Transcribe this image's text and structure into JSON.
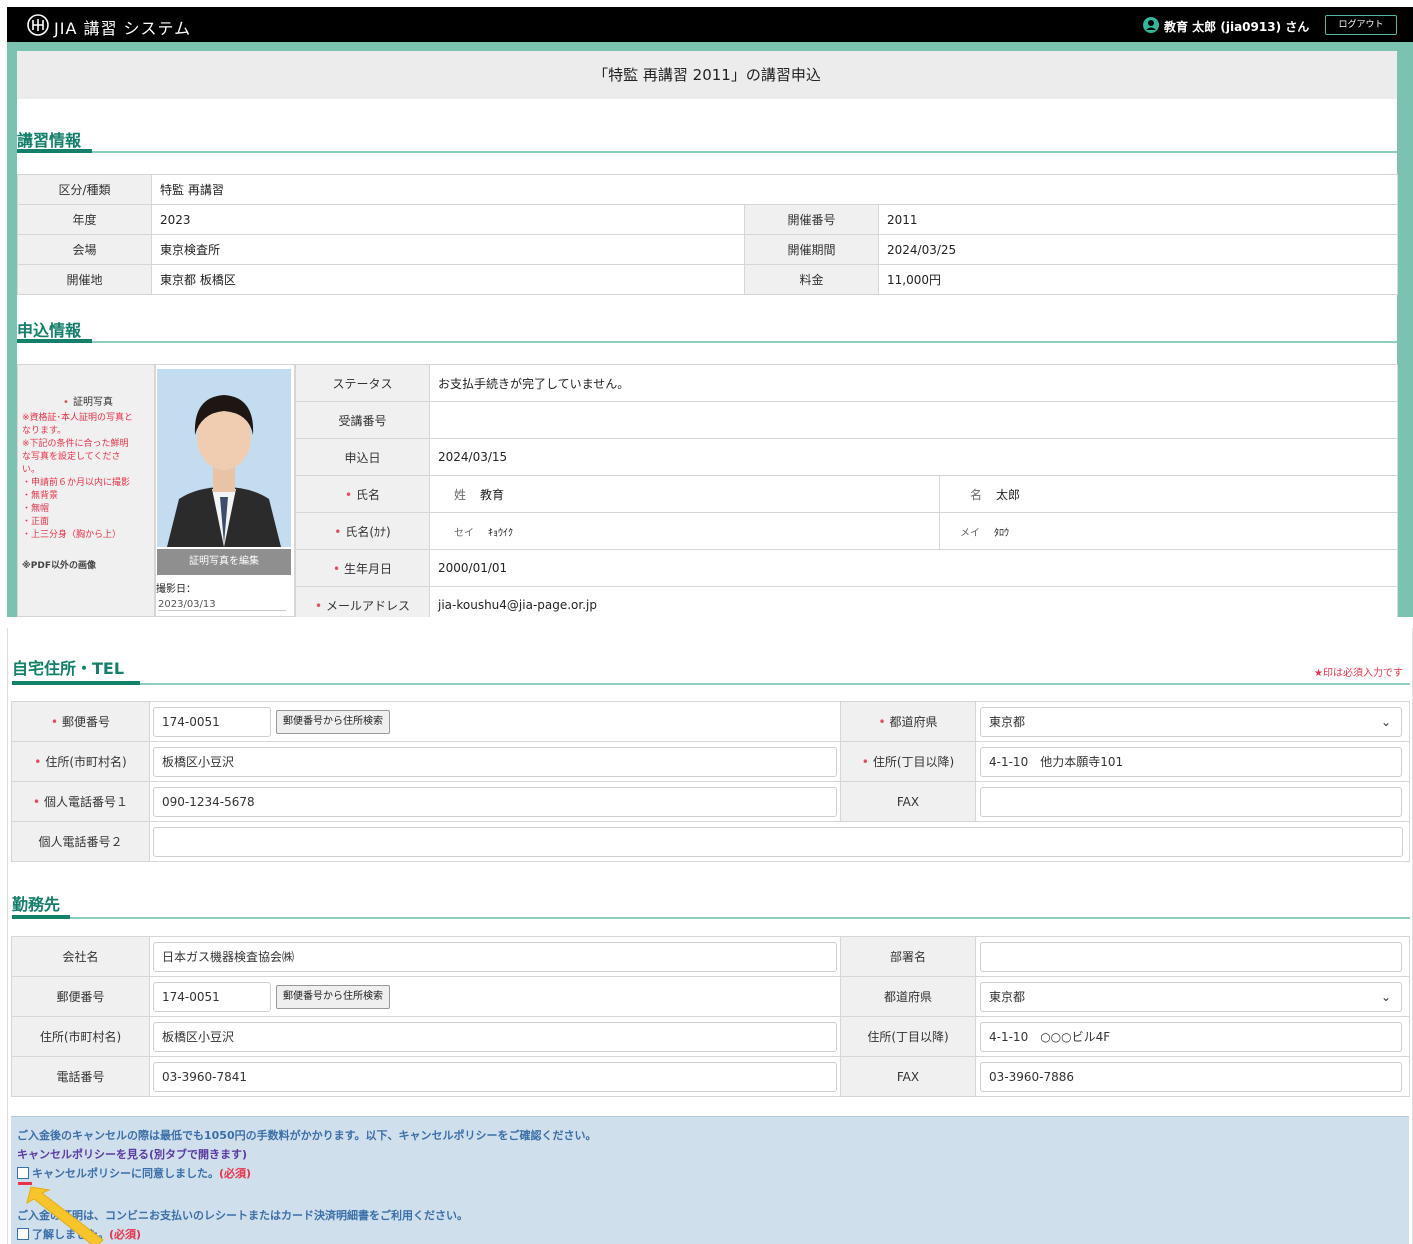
{
  "header": {
    "app_title": "JIA 講習 システム",
    "user_name": "教育 太郎 (jia0913) さん",
    "logout_label": "ログアウト"
  },
  "page_title": "「特監 再講習 2011」の講習申込",
  "course_section": {
    "heading": "講習情報",
    "rows": [
      {
        "l1": "区分/種類",
        "v1": "特監 再講習"
      },
      {
        "l1": "年度",
        "v1": "2023",
        "l2": "開催番号",
        "v2": "2011"
      },
      {
        "l1": "会場",
        "v1": "東京検査所",
        "l2": "開催期間",
        "v2": "2024/03/25"
      },
      {
        "l1": "開催地",
        "v1": "東京都 板橋区",
        "l2": "料金",
        "v2": "11,000円"
      }
    ]
  },
  "application_section": {
    "heading": "申込情報",
    "photo_note": {
      "title": "証明写真",
      "lines": [
        "※資格証･本人証明の写真と",
        "なります。",
        "※下記の条件に合った鮮明",
        "な写真を設定してくださ",
        "い。",
        "・申請前６か月以内に撮影",
        "・無背景",
        "・無帽",
        "・正面",
        "・上三分身（胸から上）"
      ],
      "pdf_note": "※PDF以外の画像"
    },
    "photo_edit_label": "証明写真を編集",
    "photo_date_label": "撮影日：",
    "photo_date": "2023/03/13",
    "status_label": "ステータス",
    "status": "お支払手続きが完了していません。",
    "exam_no_label": "受講番号",
    "exam_no": "",
    "apply_date_label": "申込日",
    "apply_date": "2024/03/15",
    "name_label": "氏名",
    "sei_label": "姓",
    "sei": "教育",
    "mei_label": "名",
    "mei": "太郎",
    "kana_label": "氏名(ｶﾅ)",
    "sei_kana_label": "セイ",
    "sei_kana": "ｷｮｳｲｸ",
    "mei_kana_label": "メイ",
    "mei_kana": "ﾀﾛｳ",
    "birth_label": "生年月日",
    "birth": "2000/01/01",
    "email_label": "メールアドレス",
    "email": "jia-koushu4@jia-page.or.jp"
  },
  "home_section": {
    "heading": "自宅住所・TEL",
    "required_note": "★印は必須入力です",
    "postal_label": "郵便番号",
    "postal": "174-0051",
    "postal_search": "郵便番号から住所検索",
    "pref_label": "都道府県",
    "pref": "東京都",
    "city_label": "住所(市町村名)",
    "city": "板橋区小豆沢",
    "street_label": "住所(丁目以降)",
    "street": "4-1-10　他力本願寺101",
    "tel1_label": "個人電話番号１",
    "tel1": "090-1234-5678",
    "fax_label": "FAX",
    "fax": "",
    "tel2_label": "個人電話番号２",
    "tel2": ""
  },
  "work_section": {
    "heading": "勤務先",
    "company_label": "会社名",
    "company": "日本ガス機器検査協会㈱",
    "dept_label": "部署名",
    "dept": "",
    "postal_label": "郵便番号",
    "postal": "174-0051",
    "postal_search": "郵便番号から住所検索",
    "pref_label": "都道府県",
    "pref": "東京都",
    "city_label": "住所(市町村名)",
    "city": "板橋区小豆沢",
    "street_label": "住所(丁目以降)",
    "street": "4-1-10　○○○ビル4F",
    "tel_label": "電話番号",
    "tel": "03-3960-7841",
    "fax_label": "FAX",
    "fax": "03-3960-7886"
  },
  "policy": {
    "cancel_text": "ご入金後のキャンセルの際は最低でも1050円の手数料がかかります。以下、キャンセルポリシーをご確認ください。",
    "policy_link": "キャンセルポリシーを見る(別タブで開きます)",
    "agree_label": "キャンセルポリシーに同意しました。",
    "required_mark": "(必須)",
    "receipt_text": "ご入金の証明は、コンビニお支払いのレシートまたはカード決済明細書をご利用ください。",
    "understood_label": "了解しました。"
  },
  "colors": {
    "accent": "#13806a",
    "header_bg": "#000000",
    "required": "#e84a5f",
    "policy_bg": "#cfe0ec"
  }
}
